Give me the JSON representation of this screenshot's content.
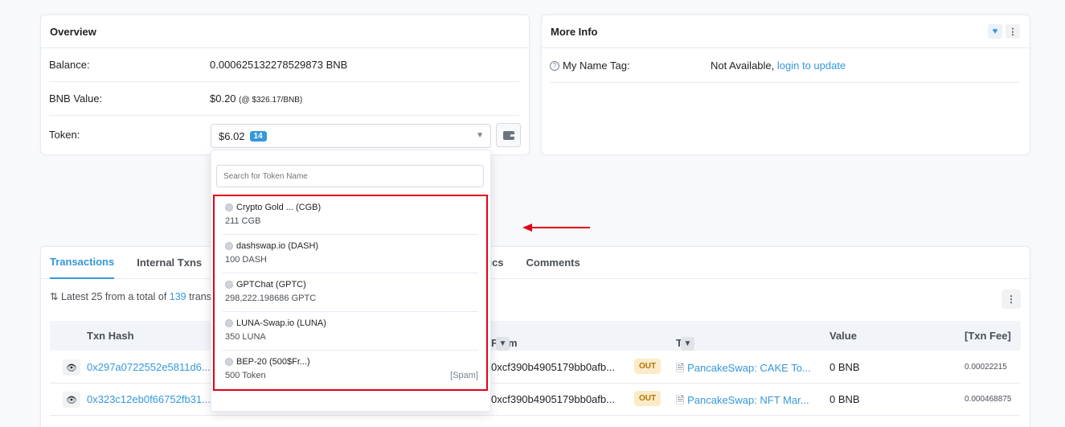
{
  "overview": {
    "title": "Overview",
    "balance_label": "Balance:",
    "balance_value": "0.000625132278529873 BNB",
    "bnb_value_label": "BNB Value:",
    "bnb_value": "$0.20",
    "bnb_rate": "(@ $326.17/BNB)",
    "token_label": "Token:",
    "token_value": "$6.02",
    "token_count": "14"
  },
  "more_info": {
    "title": "More Info",
    "name_tag_label": "My Name Tag:",
    "name_tag_value": "Not Available,",
    "name_tag_link": "login to update"
  },
  "dropdown": {
    "search_placeholder": "Search for Token Name",
    "tokens": [
      {
        "name": "Crypto Gold ... (CGB)",
        "balance": "211 CGB",
        "tag": ""
      },
      {
        "name": "dashswap.io (DASH)",
        "balance": "100 DASH",
        "tag": ""
      },
      {
        "name": "GPTChat (GPTC)",
        "balance": "298,222.198686 GPTC",
        "tag": ""
      },
      {
        "name": "LUNA-Swap.io (LUNA)",
        "balance": "350 LUNA",
        "tag": ""
      },
      {
        "name": "BEP-20 (500$Fr...)",
        "balance": "500 Token",
        "tag": "[Spam]"
      }
    ]
  },
  "transactions": {
    "tabs": [
      "Transactions",
      "Internal Txns",
      "tics",
      "Comments"
    ],
    "latest_prefix": "Latest 25 from a total of",
    "latest_count": "139",
    "latest_suffix": "trans",
    "columns": {
      "txn_hash": "Txn Hash",
      "from": "From",
      "to": "To",
      "value": "Value",
      "txn_fee": "[Txn Fee]"
    },
    "rows": [
      {
        "hash": "0x297a0722552e5811d6...",
        "from": "0xcf390b4905179bb0afb...",
        "direction": "OUT",
        "to": "PancakeSwap: CAKE To...",
        "value": "0 BNB",
        "fee": "0.00022215"
      },
      {
        "hash": "0x323c12eb0f66752fb31...",
        "from": "0xcf390b4905179bb0afb...",
        "direction": "OUT",
        "to": "PancakeSwap: NFT Mar...",
        "value": "0 BNB",
        "fee": "0.000468875"
      }
    ]
  },
  "colors": {
    "accent": "#3498db",
    "highlight": "#e2001a",
    "out_badge_bg": "#fbebc8"
  }
}
